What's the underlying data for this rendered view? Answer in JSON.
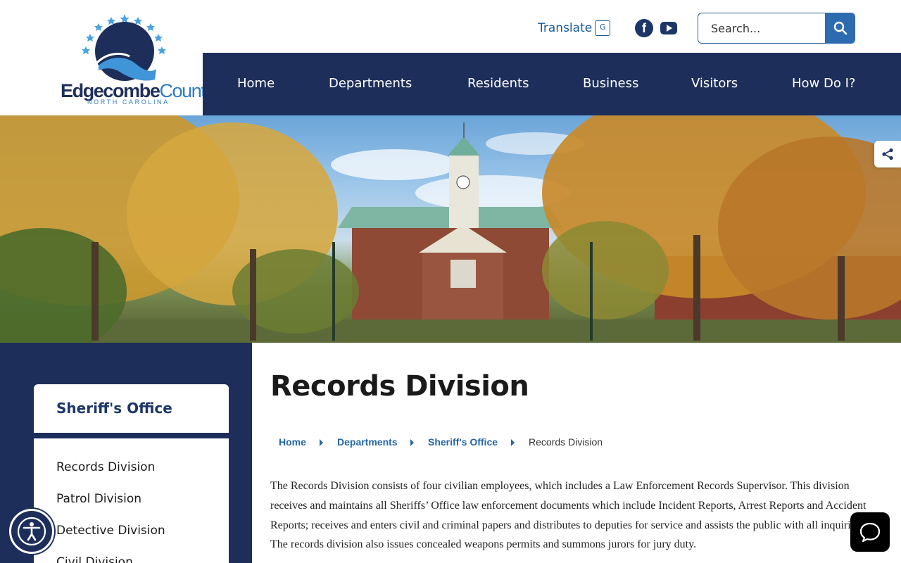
{
  "header": {
    "logo": {
      "word_main": "Edgecombe",
      "word_county": "County",
      "subtitle": "NORTH CAROLINA"
    },
    "translate_label": "Translate",
    "social": [
      {
        "name": "facebook-icon"
      },
      {
        "name": "youtube-icon"
      }
    ],
    "search": {
      "placeholder": "Search..."
    }
  },
  "nav": {
    "items": [
      {
        "label": "Home"
      },
      {
        "label": "Departments"
      },
      {
        "label": "Residents"
      },
      {
        "label": "Business"
      },
      {
        "label": "Visitors"
      },
      {
        "label": "How Do I?"
      }
    ]
  },
  "sidebar": {
    "title": "Sheriff's Office",
    "links": [
      {
        "label": "Records Division"
      },
      {
        "label": "Patrol Division"
      },
      {
        "label": "Detective Division"
      },
      {
        "label": "Civil Division"
      }
    ]
  },
  "main": {
    "title": "Records Division",
    "breadcrumb": [
      {
        "label": "Home"
      },
      {
        "label": "Departments"
      },
      {
        "label": "Sheriff's Office"
      },
      {
        "label": "Records Division"
      }
    ],
    "body": "The Records Division consists of four civilian employees, which includes a Law Enforcement Records Supervisor.  This division receives and maintains all Sheriffs’ Office law enforcement documents which include Incident Reports, Arrest Reports and Accident Reports; receives and enters civil and criminal papers and distributes to deputies for service and assists the public with all inquiries.  The records division also issues concealed weapons permits and summons jurors for jury duty."
  },
  "colors": {
    "navy": "#1d2e5a",
    "link_blue": "#2466a6",
    "search_button": "#2d6bb0"
  }
}
